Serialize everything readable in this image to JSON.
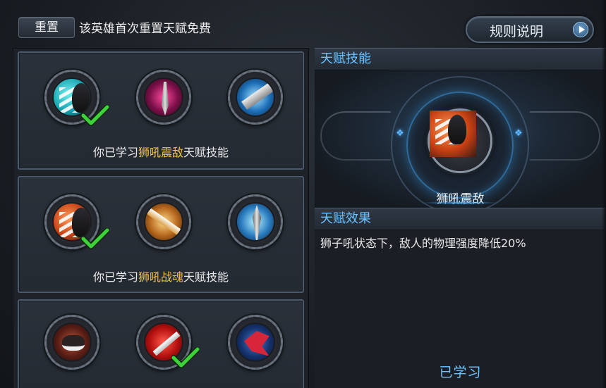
{
  "topbar": {
    "reset_label": "重置",
    "reset_note": "该英雄首次重置天赋免费",
    "rules_label": "规则说明"
  },
  "tiers": [
    {
      "caption_prefix": "你已学习",
      "caption_highlight": "狮吼震敌",
      "caption_suffix": "天赋技能",
      "skills": [
        "lion-roar-icon",
        "pink-sword-icon",
        "blue-blade-icon"
      ],
      "learned_index": 0
    },
    {
      "caption_prefix": "你已学习",
      "caption_highlight": "狮吼战魂",
      "caption_suffix": "天赋技能",
      "skills": [
        "lion-roar-icon",
        "golden-slash-icon",
        "blue-spear-icon"
      ],
      "learned_index": 0
    },
    {
      "skills": [
        "beast-maw-icon",
        "red-blade-icon",
        "red-wing-icon"
      ],
      "learned_index": 1
    }
  ],
  "detail": {
    "skill_header": "天赋技能",
    "skill_name": "狮吼震敌",
    "effect_header": "天赋效果",
    "effect_text": "狮子吼状态下，敌人的物理强度降低20%",
    "status": "已学习"
  },
  "colors": {
    "highlight": "#f2c14a",
    "accent_blue": "#6cc3ff",
    "check_green": "#3fd13a"
  }
}
